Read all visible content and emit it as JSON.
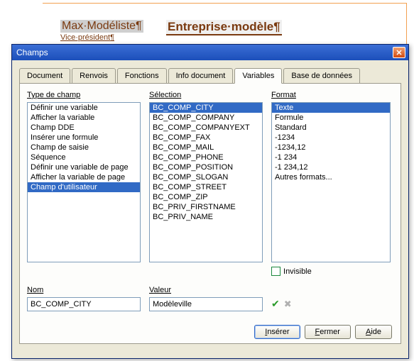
{
  "background": {
    "name_field": "Max·Modéliste¶",
    "sub_field": "Vice·président¶",
    "company_field": "Entreprise·modèle¶"
  },
  "dialog": {
    "title": "Champs",
    "tabs": [
      {
        "label": "Document"
      },
      {
        "label": "Renvois"
      },
      {
        "label": "Fonctions"
      },
      {
        "label": "Info document"
      },
      {
        "label": "Variables",
        "active": true
      },
      {
        "label": "Base de données"
      }
    ],
    "type_label": "Type de champ",
    "selection_label": "Sélection",
    "format_label": "Format",
    "types": [
      "Définir une variable",
      "Afficher la variable",
      "Champ DDE",
      "Insérer une formule",
      "Champ de saisie",
      "Séquence",
      "Définir une variable de page",
      "Afficher la variable de page",
      "Champ d'utilisateur"
    ],
    "type_selected": "Champ d'utilisateur",
    "selections": [
      "BC_COMP_CITY",
      "BC_COMP_COMPANY",
      "BC_COMP_COMPANYEXT",
      "BC_COMP_FAX",
      "BC_COMP_MAIL",
      "BC_COMP_PHONE",
      "BC_COMP_POSITION",
      "BC_COMP_SLOGAN",
      "BC_COMP_STREET",
      "BC_COMP_ZIP",
      "BC_PRIV_FIRSTNAME",
      "BC_PRIV_NAME"
    ],
    "selection_selected": "BC_COMP_CITY",
    "formats": [
      "Texte",
      "Formule",
      "Standard",
      "-1234",
      "-1234,12",
      "-1 234",
      "-1 234,12",
      "Autres formats..."
    ],
    "format_selected": "Texte",
    "invisible_label": "Invisible",
    "invisible_checked": false,
    "name_label": "Nom",
    "name_value": "BC_COMP_CITY",
    "value_label": "Valeur",
    "value_value": "Modèleville",
    "buttons": {
      "insert": "Insérer",
      "close": "Fermer",
      "help": "Aide"
    }
  }
}
